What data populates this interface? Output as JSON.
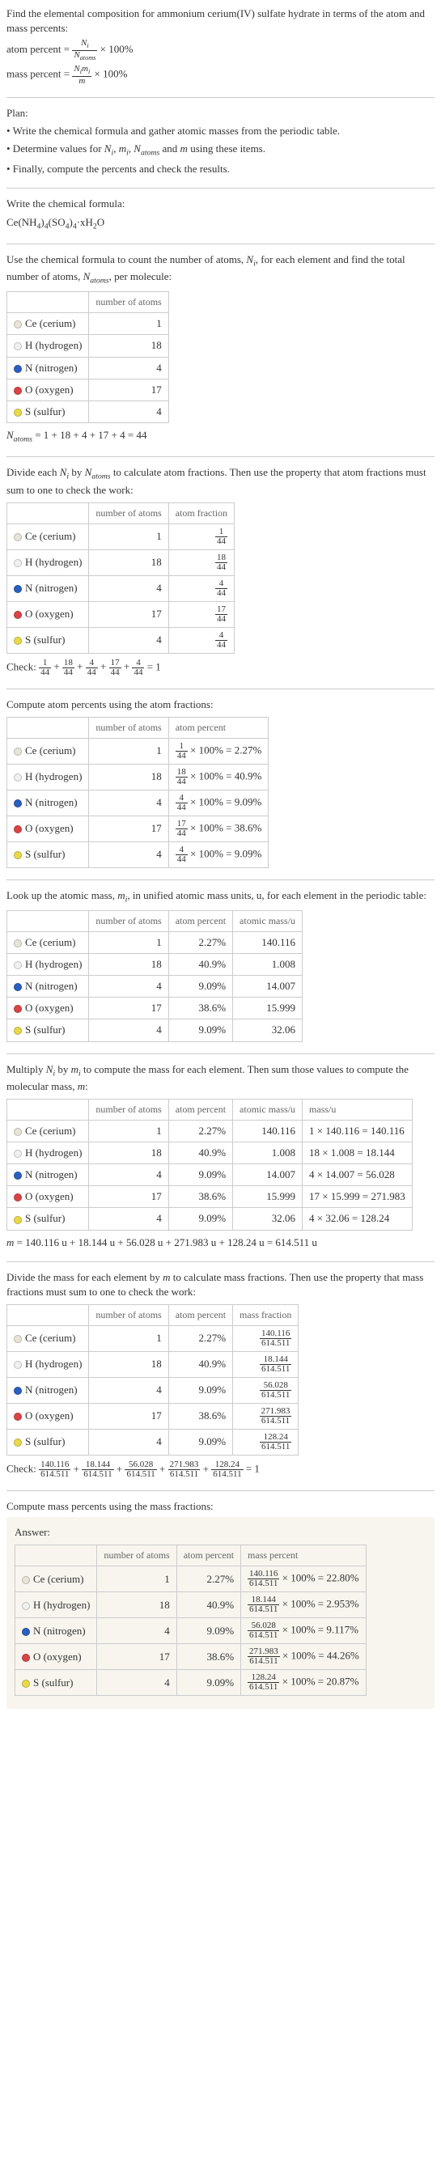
{
  "intro": "Find the elemental composition for ammonium cerium(IV) sulfate hydrate in terms of the atom and mass percents:",
  "atom_percent_eq_left": "atom percent =",
  "atom_percent_eq_right": "× 100%",
  "mass_percent_eq_left": "mass percent =",
  "mass_percent_eq_right": "× 100%",
  "N_i": "N",
  "N_i_sub": "i",
  "N_atoms": "N",
  "N_atoms_sub": "atoms",
  "Nimi_top_l": "N",
  "Nimi_top_sub": "i",
  "Nimi_top_r": "m",
  "Nimi_top_r_sub": "i",
  "Nimi_bot": "m",
  "plan_h": "Plan:",
  "plan1": "• Write the chemical formula and gather atomic masses from the periodic table.",
  "plan2_a": "• Determine values for ",
  "plan2_b": " using these items.",
  "plan2_vars": "N_i, m_i, N_atoms and m",
  "plan3": "• Finally, compute the percents and check the results.",
  "write_formula": "Write the chemical formula:",
  "formula": "Ce(NH_4)_4(SO_4)_4·xH_2O",
  "count_text_a": "Use the chemical formula to count the number of atoms, ",
  "count_text_b": ", for each element and find the total number of atoms, ",
  "count_text_c": ", per molecule:",
  "h_num_atoms": "number of atoms",
  "h_atom_frac": "atom fraction",
  "h_atom_pct": "atom percent",
  "h_mass_u": "atomic mass/u",
  "h_mass": "mass/u",
  "h_mass_frac": "mass fraction",
  "h_mass_pct": "mass percent",
  "elements": [
    {
      "name": "Ce (cerium)",
      "color": "#e8e4d8",
      "n": "1"
    },
    {
      "name": "H (hydrogen)",
      "color": "#f0f0f0",
      "n": "18"
    },
    {
      "name": "N (nitrogen)",
      "color": "#2b5fbf",
      "n": "4"
    },
    {
      "name": "O (oxygen)",
      "color": "#d94545",
      "n": "17"
    },
    {
      "name": "S (sulfur)",
      "color": "#e8d94a",
      "n": "4"
    }
  ],
  "natoms_eq": "N_atoms = 1 + 18 + 4 + 17 + 4 = 44",
  "divide_text_a": "Divide each ",
  "divide_text_b": " by ",
  "divide_text_c": " to calculate atom fractions. Then use the property that atom fractions must sum to one to check the work:",
  "atom_fracs": [
    "1/44",
    "18/44",
    "4/44",
    "17/44",
    "4/44"
  ],
  "check1_l": "Check: ",
  "check1_eq": " = 1",
  "compute_atom_pct": "Compute atom percents using the atom fractions:",
  "atom_pcts": [
    {
      "f": "1/44",
      "v": "2.27%"
    },
    {
      "f": "18/44",
      "v": "40.9%"
    },
    {
      "f": "4/44",
      "v": "9.09%"
    },
    {
      "f": "17/44",
      "v": "38.6%"
    },
    {
      "f": "4/44",
      "v": "9.09%"
    }
  ],
  "lookup_text_a": "Look up the atomic mass, ",
  "lookup_text_b": ", in unified atomic mass units, u, for each element in the periodic table:",
  "mi_var": "m_i",
  "masses": [
    "140.116",
    "1.008",
    "14.007",
    "15.999",
    "32.06"
  ],
  "pcts_short": [
    "2.27%",
    "40.9%",
    "9.09%",
    "38.6%",
    "9.09%"
  ],
  "multiply_text_a": "Multiply ",
  "multiply_text_b": " by ",
  "multiply_text_c": " to compute the mass for each element. Then sum those values to compute the molecular mass, ",
  "multiply_text_d": ":",
  "m_var": "m",
  "mass_calcs": [
    "1 × 140.116 = 140.116",
    "18 × 1.008 = 18.144",
    "4 × 14.007 = 56.028",
    "17 × 15.999 = 271.983",
    "4 × 32.06 = 128.24"
  ],
  "m_total": "m = 140.116 u + 18.144 u + 56.028 u + 271.983 u + 128.24 u = 614.511 u",
  "divide_mass_text": "Divide the mass for each element by m to calculate mass fractions. Then use the property that mass fractions must sum to one to check the work:",
  "mass_fracs": [
    "140.116/614.511",
    "18.144/614.511",
    "56.028/614.511",
    "271.983/614.511",
    "128.24/614.511"
  ],
  "check2_l": "Check: ",
  "check2_eq": " = 1",
  "compute_mass_pct": "Compute mass percents using the mass fractions:",
  "answer": "Answer:",
  "mass_pcts": [
    {
      "f": "140.116/614.511",
      "v": "22.80%"
    },
    {
      "f": "18.144/614.511",
      "v": "2.953%"
    },
    {
      "f": "56.028/614.511",
      "v": "9.117%"
    },
    {
      "f": "271.983/614.511",
      "v": "44.26%"
    },
    {
      "f": "128.24/614.511",
      "v": "20.87%"
    }
  ],
  "times100": " × 100% = "
}
